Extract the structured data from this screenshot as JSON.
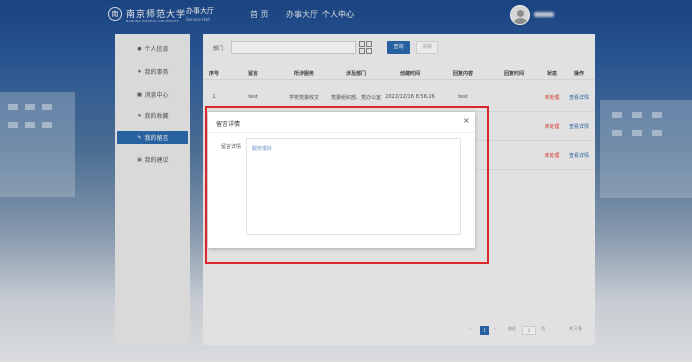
{
  "header": {
    "logo_char": "南",
    "university_name": "南京师范大学",
    "university_sub": "NANJING NORMAL UNIVERSITY",
    "system_name": "办事大厅",
    "system_sub": "Service Hall",
    "nav": [
      {
        "label": "首 页"
      },
      {
        "label": "办事大厅"
      },
      {
        "label": "个人中心"
      }
    ]
  },
  "sidebar": {
    "items": [
      {
        "label": "个人信息",
        "icon": "user-icon"
      },
      {
        "label": "我的事务",
        "icon": "task-icon"
      },
      {
        "label": "消息中心",
        "icon": "message-icon"
      },
      {
        "label": "我的收藏",
        "icon": "star-icon"
      },
      {
        "label": "我的留言",
        "icon": "comment-icon"
      },
      {
        "label": "我的建议",
        "icon": "suggestion-icon"
      }
    ],
    "active_index": 4
  },
  "filter": {
    "label": "部门",
    "value": "",
    "query_button": "查询",
    "reset_button": "清除"
  },
  "table": {
    "columns": [
      "序号",
      "留言",
      "所涉服务",
      "涉及部门",
      "创建时间",
      "回复内容",
      "回复时间",
      "状态",
      "操作"
    ],
    "rows": [
      {
        "index": "1",
        "message": "test",
        "service": "学校党委收文",
        "department": "党委组织部、党办公室",
        "created": "2022/12/16 8:56:26",
        "reply": "test",
        "reply_time": "",
        "status": "未处理",
        "action": "查看详情"
      },
      {
        "index": "",
        "message": "",
        "service": "",
        "department": "",
        "created": "",
        "reply": "",
        "reply_time": "",
        "status": "未处理",
        "action": "查看详情"
      },
      {
        "index": "",
        "message": "",
        "service": "",
        "department": "",
        "created": "",
        "reply": "",
        "reply_time": "",
        "status": "未处理",
        "action": "查看详情"
      }
    ]
  },
  "pagination": {
    "prev": "‹",
    "current": "1",
    "next": "›",
    "goto_label": "前往",
    "page_input": "1",
    "page_unit": "页",
    "total": "共 3 条"
  },
  "modal": {
    "title": "留言详情",
    "close": "×",
    "field_label": "留言详情",
    "field_value": "服务很好"
  },
  "colors": {
    "primary": "#2c6aae",
    "status_pending": "#e5392a",
    "highlight_outline": "#d9262c"
  }
}
